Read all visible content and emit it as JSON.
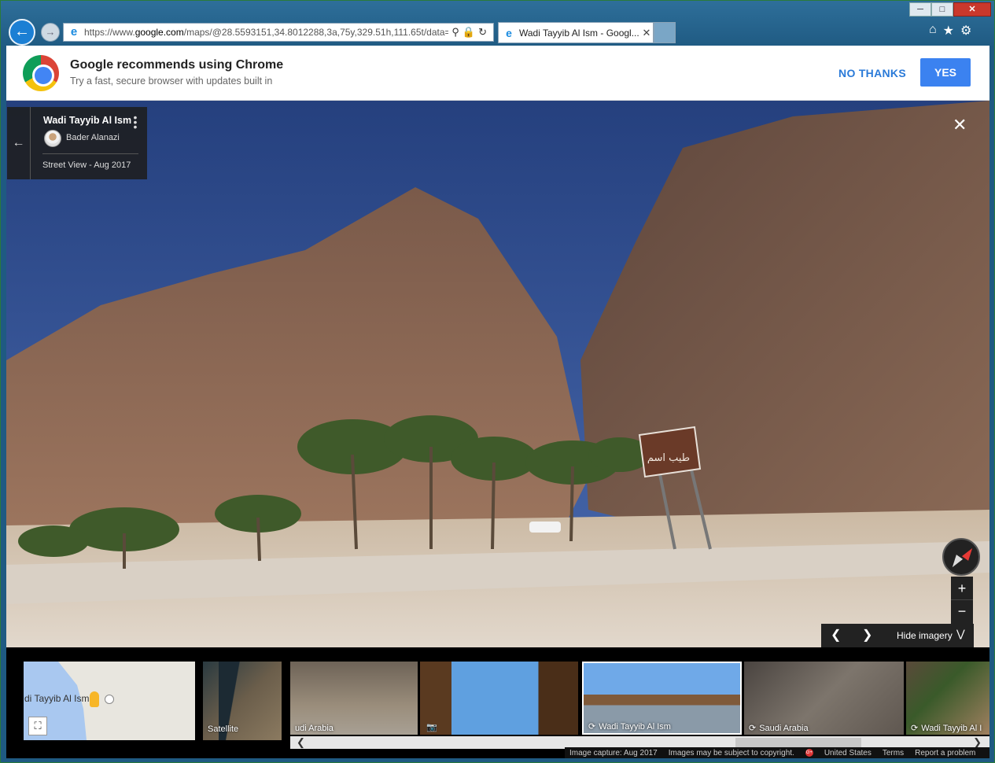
{
  "browser": {
    "window_controls": {
      "minimize": "─",
      "maximize": "□",
      "close": "✕"
    },
    "url_prefix": "https://www.",
    "url_domain": "google.com",
    "url_rest": "/maps/@28.5593151,34.8012288,3a,75y,329.51h,111.65t/data=",
    "tab_title": "Wadi Tayyib Al Ism - Googl...",
    "icons": {
      "back": "back-arrow-icon",
      "forward": "forward-arrow-icon",
      "home": "home-icon",
      "favorites": "star-icon",
      "settings": "gear-icon"
    }
  },
  "banner": {
    "title": "Google recommends using Chrome",
    "subtitle": "Try a fast, secure browser with updates built in",
    "no_thanks": "NO THANKS",
    "yes": "YES",
    "accent": "#3b82f0"
  },
  "info_card": {
    "title": "Wadi Tayyib Al Ism",
    "author": "Bader Alanazi",
    "date": "Street View - Aug 2017"
  },
  "sign_text": "طيب اسم",
  "controls": {
    "zoom_in": "+",
    "zoom_out": "−",
    "hide_imagery": "Hide imagery"
  },
  "strip": {
    "minimap_label": "di Tayyib Al Ism",
    "satellite_label": "Satellite",
    "thumbs": [
      {
        "label": "udi Arabia"
      },
      {
        "label": ""
      },
      {
        "label": "Wadi Tayyib Al Ism"
      },
      {
        "label": "Saudi Arabia"
      },
      {
        "label": "Wadi Tayyib Al I"
      }
    ]
  },
  "footer": {
    "capture": "Image capture: Aug 2017",
    "copyright": "Images may be subject to copyright.",
    "badge": "G+",
    "region": "United States",
    "terms": "Terms",
    "report": "Report a problem"
  }
}
